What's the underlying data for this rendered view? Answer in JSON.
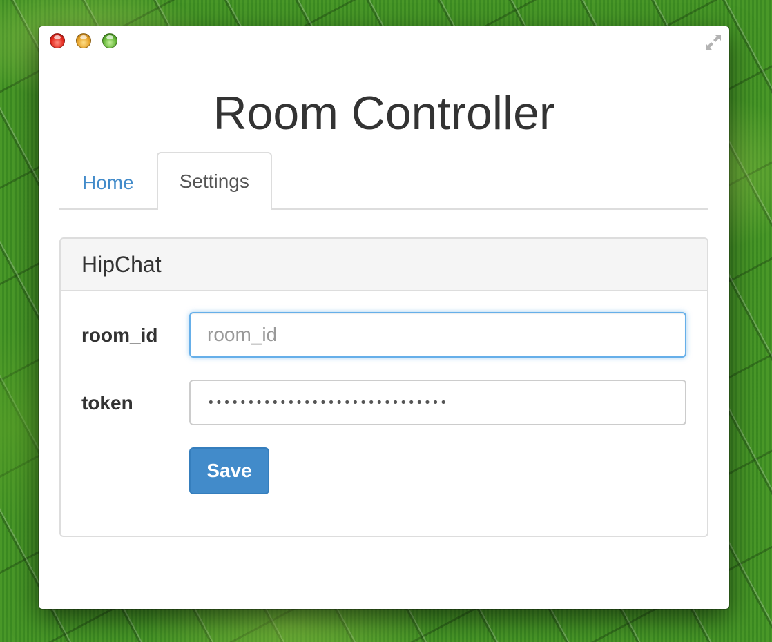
{
  "app": {
    "title": "Room Controller"
  },
  "window_controls": {
    "close_icon": "close-dot",
    "minimize_icon": "minimize-dot",
    "zoom_icon": "zoom-dot",
    "fullscreen_icon": "fullscreen-arrows-icon"
  },
  "tabs": [
    {
      "label": "Home",
      "active": false
    },
    {
      "label": "Settings",
      "active": true
    }
  ],
  "panel": {
    "heading": "HipChat",
    "fields": [
      {
        "label": "room_id",
        "placeholder": "room_id",
        "value": ""
      },
      {
        "label": "token",
        "value": "••••••••••••••••••••••••••••••"
      }
    ],
    "save_label": "Save"
  },
  "colors": {
    "accent": "#428bca",
    "title_text": "#333333",
    "focus_border": "#66afe9",
    "panel_heading_bg": "#f5f5f5"
  }
}
